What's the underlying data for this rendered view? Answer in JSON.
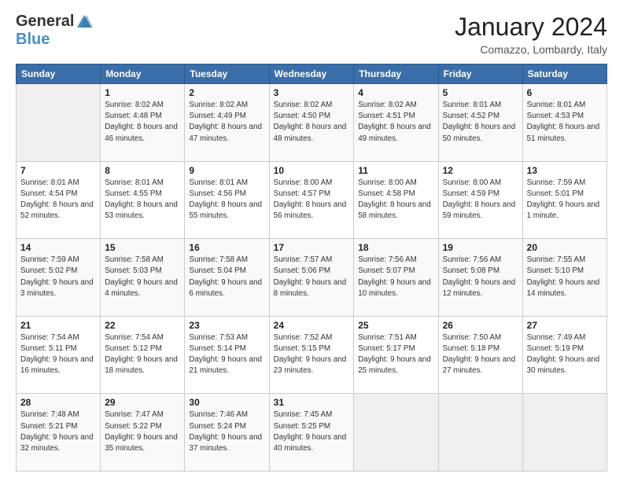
{
  "logo": {
    "general": "General",
    "blue": "Blue"
  },
  "title": "January 2024",
  "location": "Comazzo, Lombardy, Italy",
  "days_header": [
    "Sunday",
    "Monday",
    "Tuesday",
    "Wednesday",
    "Thursday",
    "Friday",
    "Saturday"
  ],
  "weeks": [
    [
      {
        "day": "",
        "sunrise": "",
        "sunset": "",
        "daylight": ""
      },
      {
        "day": "1",
        "sunrise": "Sunrise: 8:02 AM",
        "sunset": "Sunset: 4:48 PM",
        "daylight": "Daylight: 8 hours and 46 minutes."
      },
      {
        "day": "2",
        "sunrise": "Sunrise: 8:02 AM",
        "sunset": "Sunset: 4:49 PM",
        "daylight": "Daylight: 8 hours and 47 minutes."
      },
      {
        "day": "3",
        "sunrise": "Sunrise: 8:02 AM",
        "sunset": "Sunset: 4:50 PM",
        "daylight": "Daylight: 8 hours and 48 minutes."
      },
      {
        "day": "4",
        "sunrise": "Sunrise: 8:02 AM",
        "sunset": "Sunset: 4:51 PM",
        "daylight": "Daylight: 8 hours and 49 minutes."
      },
      {
        "day": "5",
        "sunrise": "Sunrise: 8:01 AM",
        "sunset": "Sunset: 4:52 PM",
        "daylight": "Daylight: 8 hours and 50 minutes."
      },
      {
        "day": "6",
        "sunrise": "Sunrise: 8:01 AM",
        "sunset": "Sunset: 4:53 PM",
        "daylight": "Daylight: 8 hours and 51 minutes."
      }
    ],
    [
      {
        "day": "7",
        "sunrise": "Sunrise: 8:01 AM",
        "sunset": "Sunset: 4:54 PM",
        "daylight": "Daylight: 8 hours and 52 minutes."
      },
      {
        "day": "8",
        "sunrise": "Sunrise: 8:01 AM",
        "sunset": "Sunset: 4:55 PM",
        "daylight": "Daylight: 8 hours and 53 minutes."
      },
      {
        "day": "9",
        "sunrise": "Sunrise: 8:01 AM",
        "sunset": "Sunset: 4:56 PM",
        "daylight": "Daylight: 8 hours and 55 minutes."
      },
      {
        "day": "10",
        "sunrise": "Sunrise: 8:00 AM",
        "sunset": "Sunset: 4:57 PM",
        "daylight": "Daylight: 8 hours and 56 minutes."
      },
      {
        "day": "11",
        "sunrise": "Sunrise: 8:00 AM",
        "sunset": "Sunset: 4:58 PM",
        "daylight": "Daylight: 8 hours and 58 minutes."
      },
      {
        "day": "12",
        "sunrise": "Sunrise: 8:00 AM",
        "sunset": "Sunset: 4:59 PM",
        "daylight": "Daylight: 8 hours and 59 minutes."
      },
      {
        "day": "13",
        "sunrise": "Sunrise: 7:59 AM",
        "sunset": "Sunset: 5:01 PM",
        "daylight": "Daylight: 9 hours and 1 minute."
      }
    ],
    [
      {
        "day": "14",
        "sunrise": "Sunrise: 7:59 AM",
        "sunset": "Sunset: 5:02 PM",
        "daylight": "Daylight: 9 hours and 3 minutes."
      },
      {
        "day": "15",
        "sunrise": "Sunrise: 7:58 AM",
        "sunset": "Sunset: 5:03 PM",
        "daylight": "Daylight: 9 hours and 4 minutes."
      },
      {
        "day": "16",
        "sunrise": "Sunrise: 7:58 AM",
        "sunset": "Sunset: 5:04 PM",
        "daylight": "Daylight: 9 hours and 6 minutes."
      },
      {
        "day": "17",
        "sunrise": "Sunrise: 7:57 AM",
        "sunset": "Sunset: 5:06 PM",
        "daylight": "Daylight: 9 hours and 8 minutes."
      },
      {
        "day": "18",
        "sunrise": "Sunrise: 7:56 AM",
        "sunset": "Sunset: 5:07 PM",
        "daylight": "Daylight: 9 hours and 10 minutes."
      },
      {
        "day": "19",
        "sunrise": "Sunrise: 7:56 AM",
        "sunset": "Sunset: 5:08 PM",
        "daylight": "Daylight: 9 hours and 12 minutes."
      },
      {
        "day": "20",
        "sunrise": "Sunrise: 7:55 AM",
        "sunset": "Sunset: 5:10 PM",
        "daylight": "Daylight: 9 hours and 14 minutes."
      }
    ],
    [
      {
        "day": "21",
        "sunrise": "Sunrise: 7:54 AM",
        "sunset": "Sunset: 5:11 PM",
        "daylight": "Daylight: 9 hours and 16 minutes."
      },
      {
        "day": "22",
        "sunrise": "Sunrise: 7:54 AM",
        "sunset": "Sunset: 5:12 PM",
        "daylight": "Daylight: 9 hours and 18 minutes."
      },
      {
        "day": "23",
        "sunrise": "Sunrise: 7:53 AM",
        "sunset": "Sunset: 5:14 PM",
        "daylight": "Daylight: 9 hours and 21 minutes."
      },
      {
        "day": "24",
        "sunrise": "Sunrise: 7:52 AM",
        "sunset": "Sunset: 5:15 PM",
        "daylight": "Daylight: 9 hours and 23 minutes."
      },
      {
        "day": "25",
        "sunrise": "Sunrise: 7:51 AM",
        "sunset": "Sunset: 5:17 PM",
        "daylight": "Daylight: 9 hours and 25 minutes."
      },
      {
        "day": "26",
        "sunrise": "Sunrise: 7:50 AM",
        "sunset": "Sunset: 5:18 PM",
        "daylight": "Daylight: 9 hours and 27 minutes."
      },
      {
        "day": "27",
        "sunrise": "Sunrise: 7:49 AM",
        "sunset": "Sunset: 5:19 PM",
        "daylight": "Daylight: 9 hours and 30 minutes."
      }
    ],
    [
      {
        "day": "28",
        "sunrise": "Sunrise: 7:48 AM",
        "sunset": "Sunset: 5:21 PM",
        "daylight": "Daylight: 9 hours and 32 minutes."
      },
      {
        "day": "29",
        "sunrise": "Sunrise: 7:47 AM",
        "sunset": "Sunset: 5:22 PM",
        "daylight": "Daylight: 9 hours and 35 minutes."
      },
      {
        "day": "30",
        "sunrise": "Sunrise: 7:46 AM",
        "sunset": "Sunset: 5:24 PM",
        "daylight": "Daylight: 9 hours and 37 minutes."
      },
      {
        "day": "31",
        "sunrise": "Sunrise: 7:45 AM",
        "sunset": "Sunset: 5:25 PM",
        "daylight": "Daylight: 9 hours and 40 minutes."
      },
      {
        "day": "",
        "sunrise": "",
        "sunset": "",
        "daylight": ""
      },
      {
        "day": "",
        "sunrise": "",
        "sunset": "",
        "daylight": ""
      },
      {
        "day": "",
        "sunrise": "",
        "sunset": "",
        "daylight": ""
      }
    ]
  ]
}
